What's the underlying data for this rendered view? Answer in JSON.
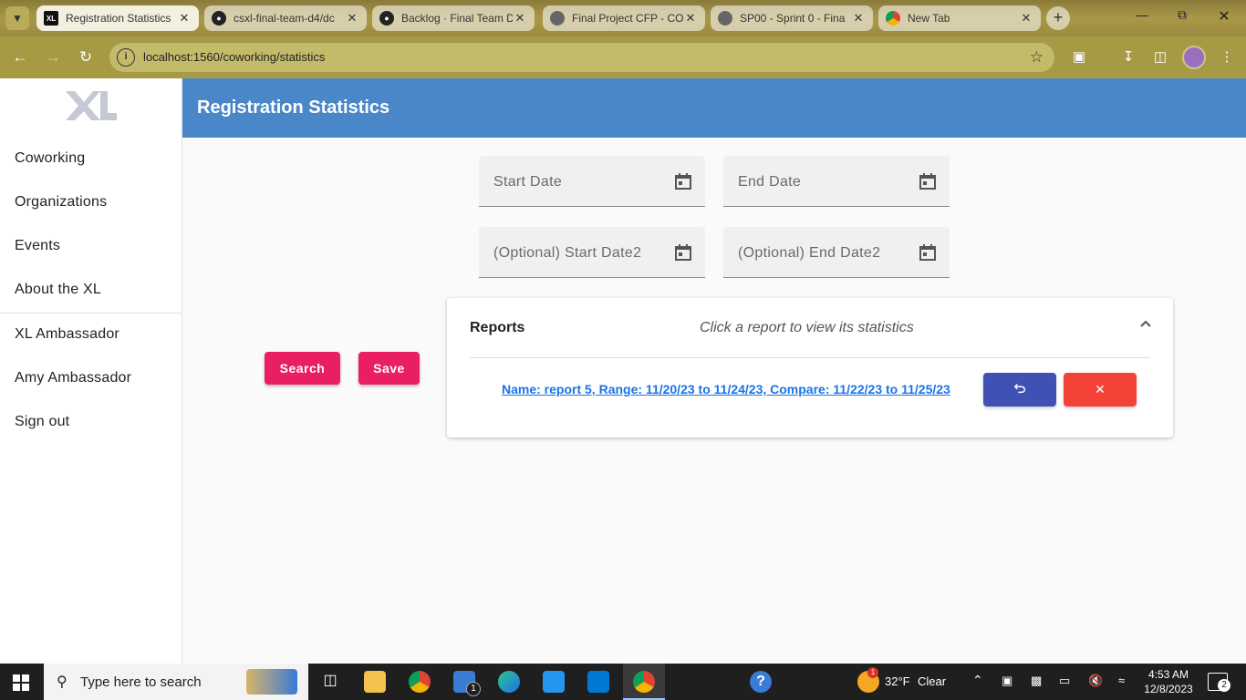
{
  "browser": {
    "tabs": [
      {
        "label": "Registration Statistics",
        "icon": "xl-icon",
        "active": true
      },
      {
        "label": "csxl-final-team-d4/dc",
        "icon": "github-icon",
        "active": false
      },
      {
        "label": "Backlog · Final Team D",
        "icon": "github-icon",
        "active": false
      },
      {
        "label": "Final Project CFP - CO",
        "icon": "globe-icon",
        "active": false
      },
      {
        "label": "SP00 - Sprint 0 - Fina",
        "icon": "globe-icon",
        "active": false
      },
      {
        "label": "New Tab",
        "icon": "chrome-icon",
        "active": false
      }
    ],
    "url": "localhost:1560/coworking/statistics"
  },
  "sidebar": {
    "logo": "XL",
    "items": [
      {
        "label": "Coworking"
      },
      {
        "label": "Organizations"
      },
      {
        "label": "Events"
      },
      {
        "label": "About the XL"
      },
      {
        "label": "XL Ambassador"
      },
      {
        "label": "Amy Ambassador"
      },
      {
        "label": "Sign out"
      }
    ]
  },
  "header": {
    "title": "Registration Statistics"
  },
  "form": {
    "start_date": "Start Date",
    "end_date": "End Date",
    "start_date2": "(Optional) Start Date2",
    "end_date2": "(Optional) End Date2"
  },
  "actions": {
    "search": "Search",
    "save": "Save"
  },
  "reports": {
    "title": "Reports",
    "description": "Click a report to view its statistics",
    "items": [
      {
        "label": "Name: report 5, Range: 11/20/23 to 11/24/23, Compare: 11/22/23 to 11/25/23",
        "restore_icon": "undo-icon",
        "delete_icon": "close-icon"
      }
    ]
  },
  "taskbar": {
    "search_placeholder": "Type here to search",
    "weather_temp": "32°F",
    "weather_desc": "Clear",
    "time": "4:53 AM",
    "date": "12/8/2023",
    "notification_count": "2",
    "mail_badge": "1",
    "weather_badge": "1"
  },
  "colors": {
    "header": "#4a87c8",
    "primary_button": "#e91e63",
    "restore_button": "#3f51b5",
    "delete_button": "#f44336",
    "link": "#1a73e8"
  }
}
